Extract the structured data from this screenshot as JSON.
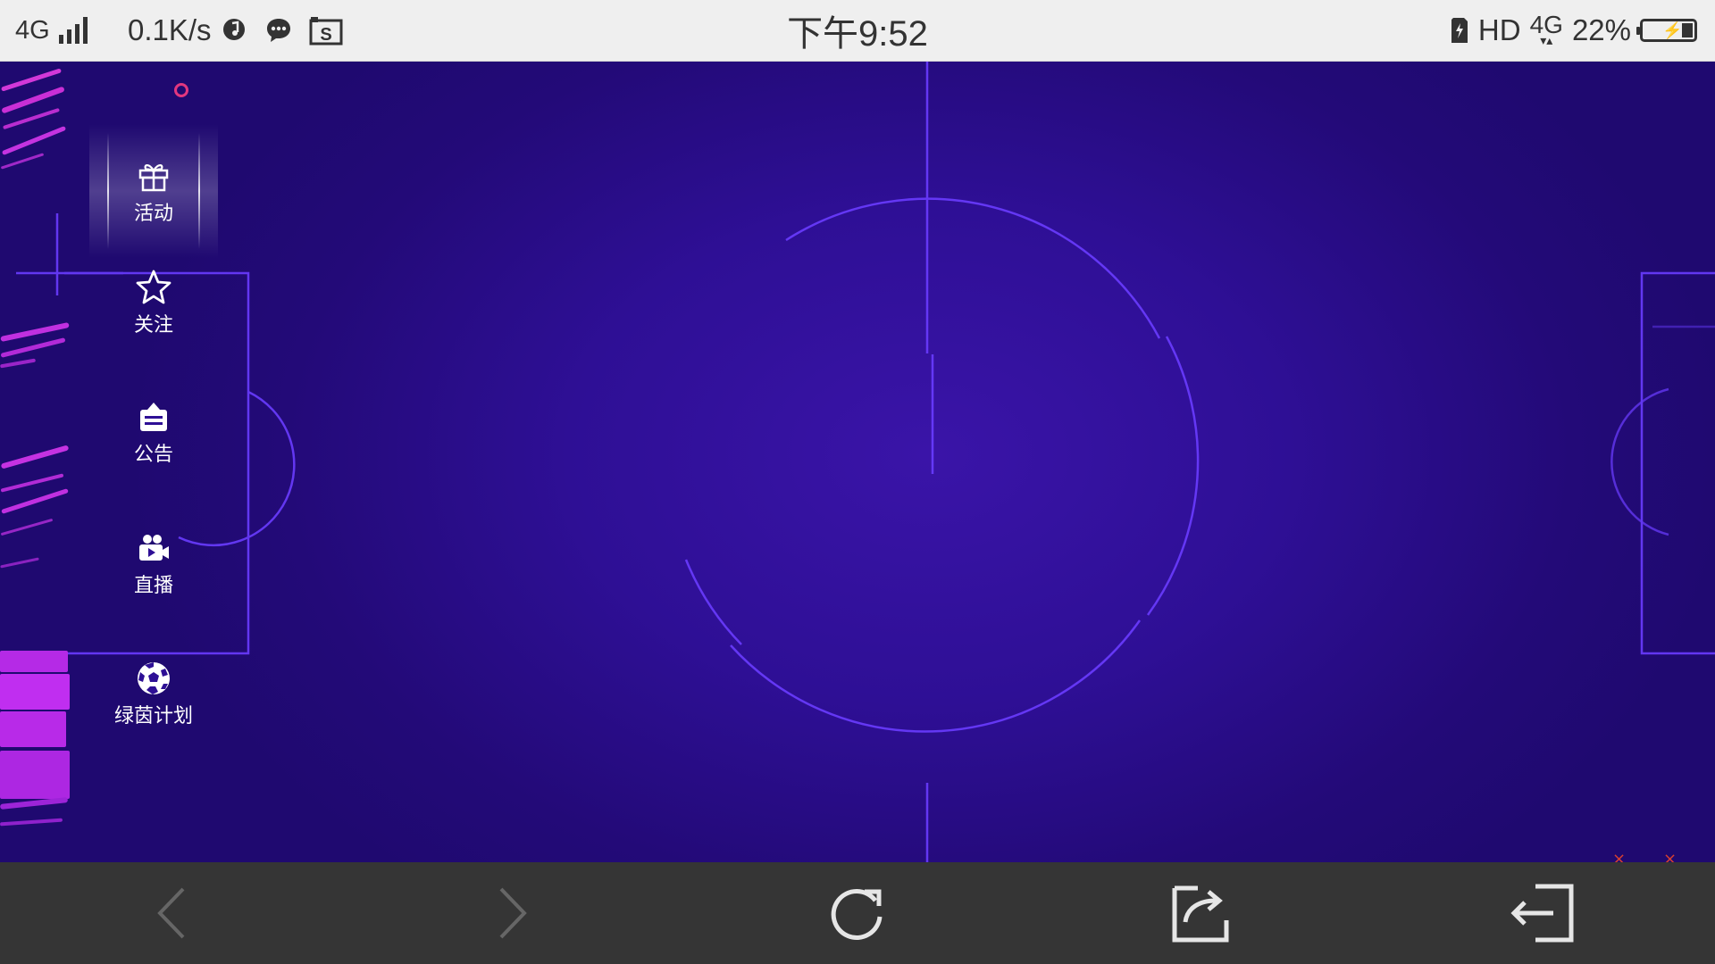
{
  "status_bar": {
    "network": "4G",
    "speed": "0.1K/s",
    "time": "下午9:52",
    "hd": "HD",
    "data_type": "4G",
    "battery": "22%",
    "battery_level": 0.22
  },
  "side_menu": {
    "items": [
      {
        "label": "活动",
        "icon": "gift-icon",
        "active": true
      },
      {
        "label": "关注",
        "icon": "star-icon"
      },
      {
        "label": "公告",
        "icon": "notice-board-icon"
      },
      {
        "label": "直播",
        "icon": "video-camera-icon"
      },
      {
        "label": "绿茵计划",
        "icon": "soccer-ball-icon"
      }
    ]
  },
  "bottom_nav": {
    "items": [
      {
        "name": "back-button",
        "icon": "chevron-left-icon",
        "enabled": false
      },
      {
        "name": "forward-button",
        "icon": "chevron-right-icon",
        "enabled": false
      },
      {
        "name": "refresh-button",
        "icon": "refresh-icon",
        "enabled": true
      },
      {
        "name": "share-button",
        "icon": "share-icon",
        "enabled": true
      },
      {
        "name": "exit-button",
        "icon": "exit-icon",
        "enabled": true
      }
    ]
  },
  "colors": {
    "field_bg": "#2e0f95",
    "field_line": "#6a3cff",
    "accent_magenta": "#c020e8",
    "status_bar_bg": "#efefef",
    "nav_bg": "#353535",
    "menu_dot": "#e2377f"
  }
}
